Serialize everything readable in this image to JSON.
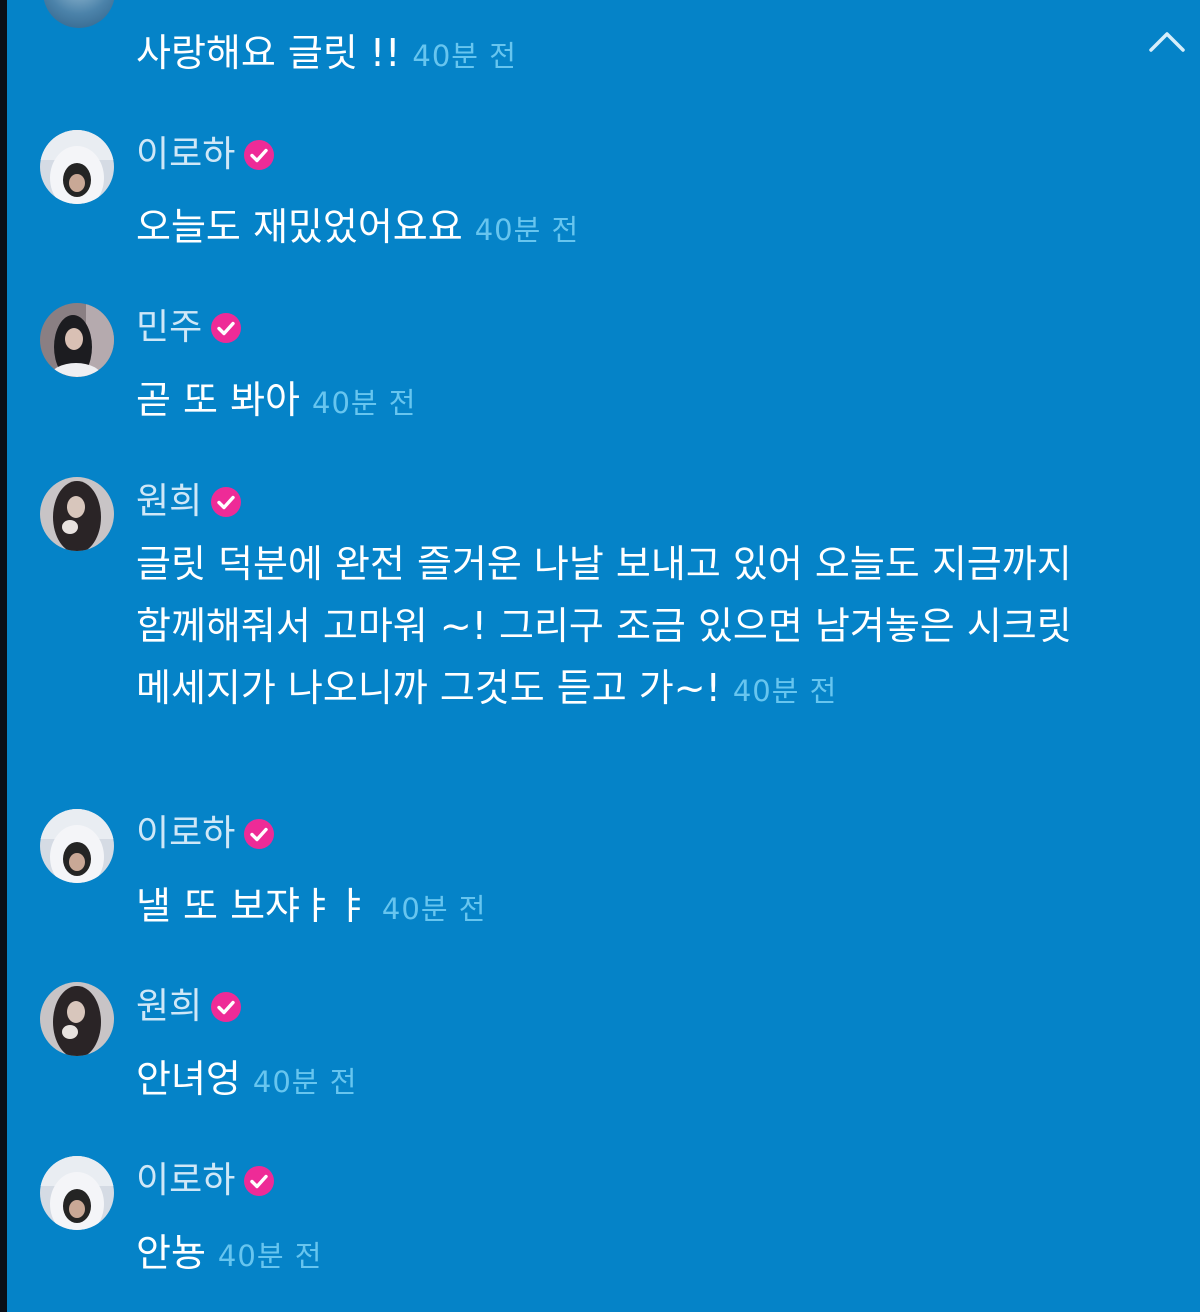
{
  "header": {
    "message": "사랑해요 글릿 !!",
    "time": "40분 전"
  },
  "messages": [
    {
      "author": "이로하",
      "text": "오늘도 재밌었어요요",
      "time": "40분 전"
    },
    {
      "author": "민주",
      "text": "곧 또 봐아",
      "time": "40분 전"
    },
    {
      "author": "원희",
      "text": "글릿 덕분에 완전 즐거운 나날 보내고 있어 오늘도 지금까지 함께해줘서 고마워 ~! 그리구 조금 있으면 남겨놓은 시크릿 메세지가 나오니까 그것도 듣고 가~!",
      "time": "40분 전"
    },
    {
      "author": "이로하",
      "text": "낼 또 보쟈ㅑㅑ",
      "time": "40분 전"
    },
    {
      "author": "원희",
      "text": "안녀엉",
      "time": "40분 전"
    },
    {
      "author": "이로하",
      "text": "안뇽",
      "time": "40분 전"
    }
  ],
  "colors": {
    "background": "#0583c8",
    "verified_badge": "#ee2b97",
    "timestamp": "#67c5ef",
    "author_name": "#cfe7f7"
  },
  "icons": {
    "collapse": "chevron-up-icon",
    "verified": "verified-badge-icon"
  }
}
